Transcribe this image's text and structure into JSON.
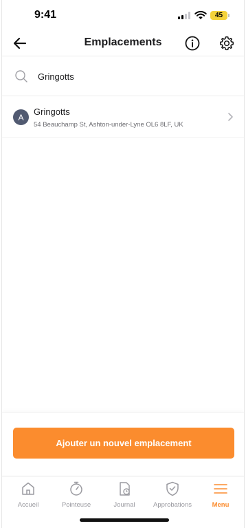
{
  "status": {
    "time": "9:41",
    "battery": "45"
  },
  "header": {
    "title": "Emplacements",
    "back_icon": "arrow-left-icon",
    "info_icon": "info-icon",
    "settings_icon": "gear-icon"
  },
  "search": {
    "value": "Gringotts",
    "icon": "search-icon"
  },
  "locations": [
    {
      "avatar": "A",
      "name": "Gringotts",
      "address": "54 Beauchamp St, Ashton-under-Lyne OL6 8LF, UK"
    }
  ],
  "action": {
    "add_label": "Ajouter un nouvel emplacement"
  },
  "tabs": [
    {
      "label": "Accueil",
      "icon": "home-icon",
      "active": false
    },
    {
      "label": "Pointeuse",
      "icon": "stopwatch-icon",
      "active": false
    },
    {
      "label": "Journal",
      "icon": "journal-icon",
      "active": false
    },
    {
      "label": "Approbations",
      "icon": "shield-check-icon",
      "active": false
    },
    {
      "label": "Menu",
      "icon": "menu-icon",
      "active": true
    }
  ],
  "colors": {
    "accent": "#fb8c2e",
    "avatar_bg": "#515a71",
    "battery": "#f5d33a",
    "inactive_tab": "#9a9aa0"
  }
}
